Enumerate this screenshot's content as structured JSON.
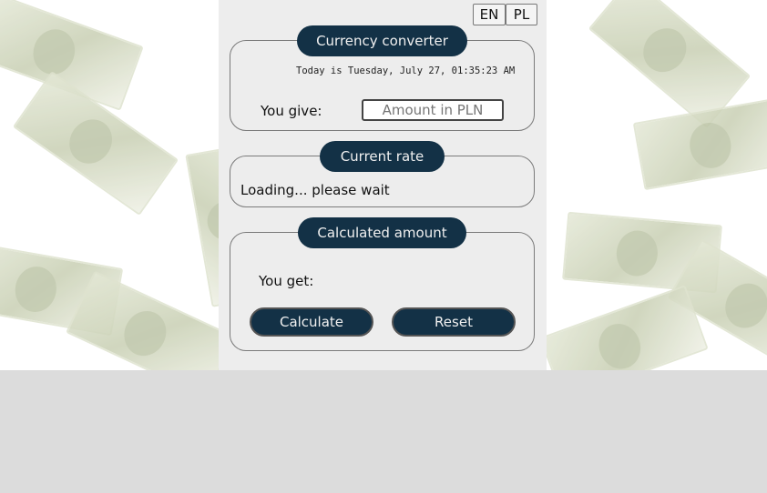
{
  "lang": {
    "en": "EN",
    "pl": "PL"
  },
  "converter": {
    "title": "Currency converter",
    "date": "Today is Tuesday, July 27, 01:35:23 AM",
    "give_label": "You give:",
    "amount_placeholder": "Amount in PLN"
  },
  "rate": {
    "title": "Current rate",
    "status": "Loading... please wait"
  },
  "calc": {
    "title": "Calculated amount",
    "get_label": "You get:",
    "calculate": "Calculate",
    "reset": "Reset"
  }
}
